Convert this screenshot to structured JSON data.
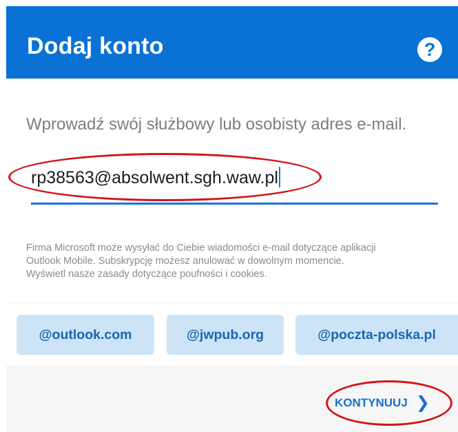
{
  "header": {
    "title": "Dodaj konto",
    "help_icon": "help-question-icon",
    "help_glyph": "?"
  },
  "form": {
    "prompt": "Wprowadź swój służbowy lub osobisty adres e-mail.",
    "email_value": "rp38563@absolwent.sgh.waw.pl"
  },
  "notice": {
    "line1": "Firma Microsoft może wysyłać do Ciebie wiadomości e-mail dotyczące aplikacji",
    "line2": "Outlook Mobile. Subskrypcję możesz anulować w dowolnym momencie.",
    "line3": "Wyświetl nasze zasady dotyczące poufności i cookies."
  },
  "suggestions": [
    {
      "label": "@outlook.com"
    },
    {
      "label": "@jwpub.org"
    },
    {
      "label": "@poczta-polska.pl"
    }
  ],
  "footer": {
    "continue_label": "KONTYNUUJ",
    "continue_icon": "chevron-right-icon",
    "continue_glyph": "❯"
  },
  "colors": {
    "header_bg": "#0a72d4",
    "accent": "#1a73e8",
    "chip_bg": "#cde4f7",
    "chip_text": "#1767b2",
    "annotation_red": "#d3141a"
  }
}
